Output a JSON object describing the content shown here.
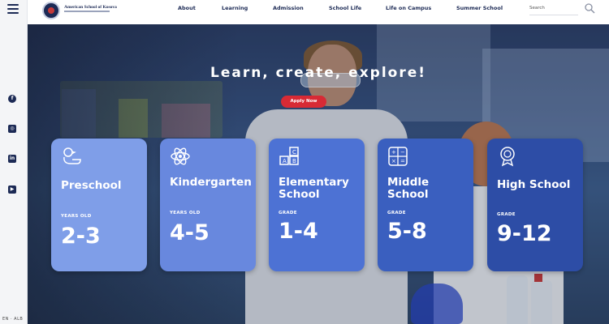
{
  "school": {
    "logo_text": "American School of Kosova"
  },
  "nav": {
    "items": [
      "About",
      "Learning",
      "Admission",
      "School Life",
      "Life on Campus",
      "Summer School"
    ],
    "search_label": "Search"
  },
  "sidebar": {
    "social_icons": [
      "facebook-icon",
      "instagram-icon",
      "linkedin-icon",
      "youtube-icon"
    ],
    "language": "EN · ALB"
  },
  "hero": {
    "title": "Learn, create, explore!",
    "cta_label": "Apply Now"
  },
  "cards": [
    {
      "title": "Preschool",
      "sublabel": "YEARS OLD",
      "range": "2-3",
      "icon": "duck-icon",
      "color": "#7f9ee8"
    },
    {
      "title": "Kindergarten",
      "sublabel": "YEARS OLD",
      "range": "4-5",
      "icon": "atom-icon",
      "color": "#6888de"
    },
    {
      "title": "Elementary School",
      "sublabel": "GRADE",
      "range": "1-4",
      "icon": "blocks-icon",
      "color": "#4d72d4"
    },
    {
      "title": "Middle School",
      "sublabel": "GRADE",
      "range": "5-8",
      "icon": "calculator-icon",
      "color": "#3a5fbf"
    },
    {
      "title": "High School",
      "sublabel": "GRADE",
      "range": "9-12",
      "icon": "medal-icon",
      "color": "#2d4da6"
    }
  ],
  "colors": {
    "brand_navy": "#1c2a55",
    "cta_red": "#d72a35"
  }
}
